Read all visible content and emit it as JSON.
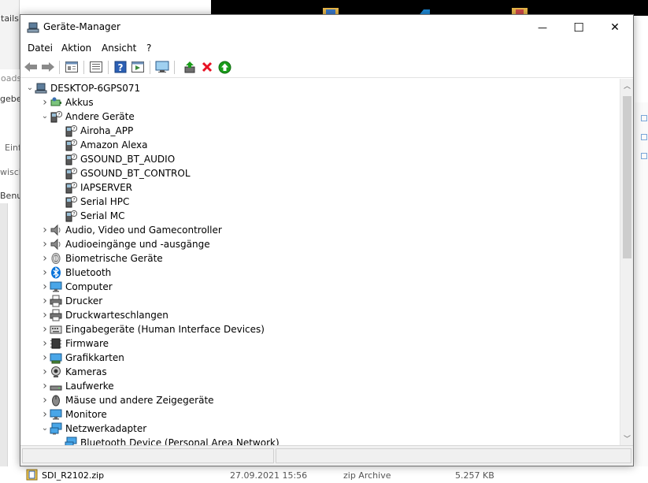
{
  "background": {
    "tab_texts": [
      "tails",
      "oads",
      "geber",
      "Einf",
      "wisch",
      "Benu"
    ],
    "file_row": {
      "name": "SDI_R2102.zip",
      "date": "27.09.2021 15:56",
      "type": "zip Archive",
      "size": "5.257 KB"
    }
  },
  "window": {
    "title": "Geräte-Manager",
    "controls": {
      "minimize": "—",
      "maximize": "☐",
      "close": "✕"
    }
  },
  "menu": [
    "Datei",
    "Aktion",
    "Ansicht",
    "?"
  ],
  "toolbar_icons": [
    "back-icon",
    "forward-icon",
    "properties-view-icon",
    "list-view-icon",
    "help-icon",
    "action-view-icon",
    "monitor-scan-icon",
    "update-driver-icon",
    "uninstall-icon",
    "enable-device-icon"
  ],
  "tree": {
    "root": "DESKTOP-6GPS071",
    "items": [
      {
        "label": "Akkus",
        "level": 1,
        "expand": "collapsed",
        "icon": "battery-icon"
      },
      {
        "label": "Andere Geräte",
        "level": 1,
        "expand": "expanded",
        "icon": "unknown-device-icon"
      },
      {
        "label": "Airoha_APP",
        "level": 2,
        "expand": "none",
        "icon": "unknown-device-icon"
      },
      {
        "label": "Amazon Alexa",
        "level": 2,
        "expand": "none",
        "icon": "unknown-device-icon"
      },
      {
        "label": "GSOUND_BT_AUDIO",
        "level": 2,
        "expand": "none",
        "icon": "unknown-device-icon"
      },
      {
        "label": "GSOUND_BT_CONTROL",
        "level": 2,
        "expand": "none",
        "icon": "unknown-device-icon"
      },
      {
        "label": "IAPSERVER",
        "level": 2,
        "expand": "none",
        "icon": "unknown-device-icon"
      },
      {
        "label": "Serial HPC",
        "level": 2,
        "expand": "none",
        "icon": "unknown-device-icon"
      },
      {
        "label": "Serial MC",
        "level": 2,
        "expand": "none",
        "icon": "unknown-device-icon"
      },
      {
        "label": "Audio, Video und Gamecontroller",
        "level": 1,
        "expand": "collapsed",
        "icon": "speaker-icon"
      },
      {
        "label": "Audioeingänge und -ausgänge",
        "level": 1,
        "expand": "collapsed",
        "icon": "speaker-icon"
      },
      {
        "label": "Biometrische Geräte",
        "level": 1,
        "expand": "collapsed",
        "icon": "fingerprint-icon"
      },
      {
        "label": "Bluetooth",
        "level": 1,
        "expand": "collapsed",
        "icon": "bluetooth-icon"
      },
      {
        "label": "Computer",
        "level": 1,
        "expand": "collapsed",
        "icon": "monitor-icon"
      },
      {
        "label": "Drucker",
        "level": 1,
        "expand": "collapsed",
        "icon": "printer-icon"
      },
      {
        "label": "Druckwarteschlangen",
        "level": 1,
        "expand": "collapsed",
        "icon": "printer-icon"
      },
      {
        "label": "Eingabegeräte (Human Interface Devices)",
        "level": 1,
        "expand": "collapsed",
        "icon": "keyboard-icon"
      },
      {
        "label": "Firmware",
        "level": 1,
        "expand": "collapsed",
        "icon": "chip-icon"
      },
      {
        "label": "Grafikkarten",
        "level": 1,
        "expand": "collapsed",
        "icon": "display-adapter-icon"
      },
      {
        "label": "Kameras",
        "level": 1,
        "expand": "collapsed",
        "icon": "camera-icon"
      },
      {
        "label": "Laufwerke",
        "level": 1,
        "expand": "collapsed",
        "icon": "drive-icon"
      },
      {
        "label": "Mäuse und andere Zeigegeräte",
        "level": 1,
        "expand": "collapsed",
        "icon": "mouse-icon"
      },
      {
        "label": "Monitore",
        "level": 1,
        "expand": "collapsed",
        "icon": "monitor-icon"
      },
      {
        "label": "Netzwerkadapter",
        "level": 1,
        "expand": "expanded",
        "icon": "network-icon"
      },
      {
        "label": "Bluetooth Device (Personal Area Network)",
        "level": 2,
        "expand": "none",
        "icon": "network-icon"
      }
    ]
  },
  "colors": {
    "accent_blue": "#1e73be",
    "bluetooth": "#0a74da",
    "uninstall_red": "#e81123",
    "enable_green": "#1a9c1a",
    "help_blue": "#2b5fb4"
  }
}
